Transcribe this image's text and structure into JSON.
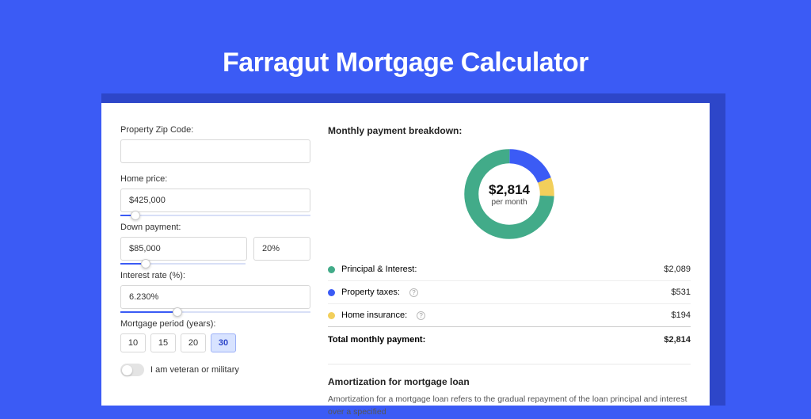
{
  "title": "Farragut Mortgage Calculator",
  "form": {
    "zip": {
      "label": "Property Zip Code:",
      "value": ""
    },
    "home_price": {
      "label": "Home price:",
      "value": "$425,000",
      "slider_pct": 8
    },
    "down_payment": {
      "label": "Down payment:",
      "value": "$85,000",
      "pct_value": "20%",
      "slider_pct": 20
    },
    "interest": {
      "label": "Interest rate (%):",
      "value": "6.230%",
      "slider_pct": 30
    },
    "mortgage_period": {
      "label": "Mortgage period (years):",
      "options": [
        "10",
        "15",
        "20",
        "30"
      ],
      "active": "30"
    },
    "veteran": {
      "label": "I am veteran or military",
      "on": false
    }
  },
  "breakdown": {
    "title": "Monthly payment breakdown:",
    "center_amount": "$2,814",
    "center_sub": "per month",
    "items": [
      {
        "label": "Principal & Interest:",
        "value": "$2,089",
        "num": 2089,
        "color": "#42ab89",
        "info": false
      },
      {
        "label": "Property taxes:",
        "value": "$531",
        "num": 531,
        "color": "#3b5bf5",
        "info": true
      },
      {
        "label": "Home insurance:",
        "value": "$194",
        "num": 194,
        "color": "#f2cf5b",
        "info": true
      }
    ],
    "total": {
      "label": "Total monthly payment:",
      "value": "$2,814"
    }
  },
  "amort": {
    "title": "Amortization for mortgage loan",
    "text": "Amortization for a mortgage loan refers to the gradual repayment of the loan principal and interest over a specified"
  },
  "chart_data": {
    "type": "pie",
    "title": "Monthly payment breakdown",
    "series": [
      {
        "name": "Principal & Interest",
        "value": 2089
      },
      {
        "name": "Property taxes",
        "value": 531
      },
      {
        "name": "Home insurance",
        "value": 194
      }
    ],
    "total": 2814
  }
}
